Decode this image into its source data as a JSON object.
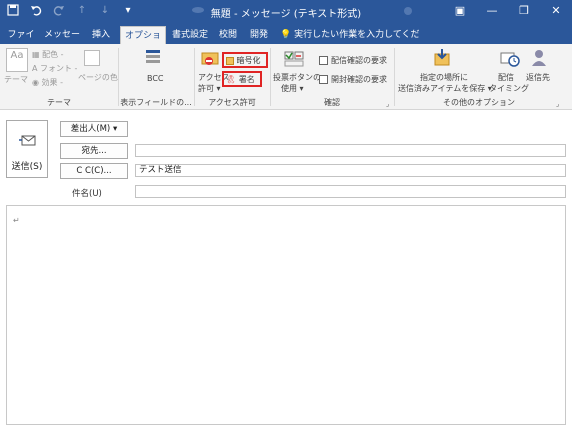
{
  "window": {
    "title": "無題 - メッセージ (テキスト形式)",
    "qat_icons": [
      "save-icon",
      "undo-icon",
      "redo-icon",
      "up-arrow-icon",
      "down-arrow-icon",
      "customize-qat-icon"
    ],
    "controls": {
      "ribbon_options": "▣",
      "minimize": "—",
      "restore": "❐",
      "close": "✕"
    }
  },
  "tabs": [
    "ファイル",
    "メッセージ",
    "挿入",
    "オプション",
    "書式設定",
    "校閲",
    "開発"
  ],
  "active_tab": "オプション",
  "tell_me": "実行したい作業を入力してください",
  "ribbon": {
    "theme_group": {
      "label": "テーマ",
      "theme_btn": "テーマ",
      "colors": "配色 -",
      "fonts": "フォント -",
      "effects": "効果 -",
      "page_color": "ページの色"
    },
    "show_fields_group": {
      "label": "表示フィールドの...",
      "bcc": "BCC"
    },
    "permission_group": {
      "label": "アクセス許可",
      "permission_btn": "アクセス",
      "permission_btn2": "許可",
      "encrypt": "暗号化",
      "sign": "署名"
    },
    "tracking_group": {
      "label": "確認",
      "voting_btn": "投票ボタンの",
      "voting_btn2": "使用",
      "delivery_receipt": "配信確認の要求",
      "read_receipt": "開封確認の要求"
    },
    "more_options_group": {
      "label": "その他のオプション",
      "save_sent": "指定の場所に",
      "save_sent2": "送信済みアイテムを保存",
      "delay": "配信",
      "delay2": "タイミング",
      "reply_to": "返信先"
    }
  },
  "compose": {
    "send": "送信(S)",
    "from": "差出人(M) ▾",
    "to": "宛先...",
    "cc": "C C(C)...",
    "subject_label": "件名(U)",
    "to_value": "",
    "cc_value": "テスト送信",
    "subject_value": "",
    "body_mark": "↵"
  },
  "colors": {
    "accent": "#2b579a",
    "highlight": "#e02424"
  }
}
